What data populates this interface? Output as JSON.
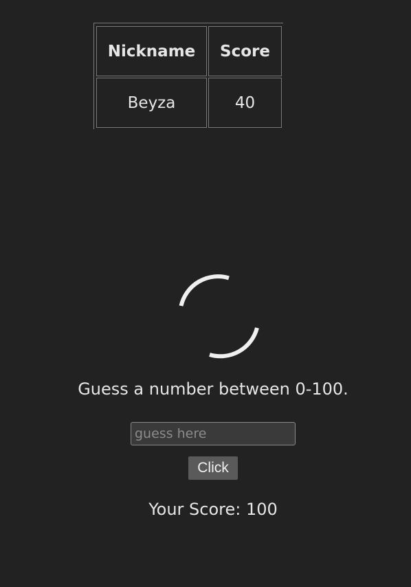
{
  "scoreboard": {
    "headers": {
      "nickname": "Nickname",
      "score": "Score"
    },
    "rows": [
      {
        "nickname": "Beyza",
        "score": "40"
      }
    ]
  },
  "spinner": {
    "icon": "loading-spinner-icon",
    "color": "#f0f0f0"
  },
  "game": {
    "prompt": "Guess a number between 0-100.",
    "input_placeholder": "guess here",
    "input_value": "",
    "button_label": "Click",
    "score_text": "Your Score: 100"
  },
  "colors": {
    "background": "#222222",
    "text": "#e6e6e6",
    "border": "#7a7a7a",
    "button": "#5a5a5a"
  }
}
